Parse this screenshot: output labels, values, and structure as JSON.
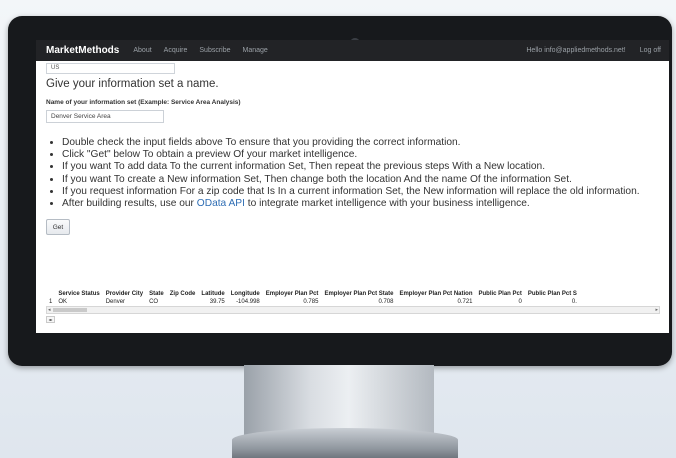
{
  "navbar": {
    "brand": "MarketMethods",
    "links": [
      "About",
      "Acquire",
      "Subscribe",
      "Manage"
    ],
    "greeting": "Hello info@appliedmethods.net!",
    "logoff": "Log off"
  },
  "form": {
    "country_value": "US",
    "section_title": "Give your information set a name.",
    "name_label": "Name of your information set (Example: Service Area Analysis)",
    "name_value": "Denver Service Area"
  },
  "instructions": [
    "Double check the input fields above To ensure that you providing the correct information.",
    "Click \"Get\" below To obtain a preview Of your market intelligence.",
    "If you want To add data To the current information Set, Then repeat the previous steps With a New location.",
    "If you want To create a New information Set, Then change both the location And the name Of the information Set.",
    "If you request information For a zip code that Is In a current information Set, the New information will replace the old information."
  ],
  "last_instruction": {
    "before": "After building results, use our ",
    "link": "OData API",
    "after": " to integrate market intelligence with your business intelligence."
  },
  "get_button": "Get",
  "results": {
    "columns": [
      "",
      "Service Status",
      "Provider City",
      "State",
      "Zip Code",
      "Latitude",
      "Longitude",
      "Employer Plan Pct",
      "Employer Plan Pct State",
      "Employer Plan Pct Nation",
      "Public Plan Pct",
      "Public Plan Pct S"
    ],
    "rows": [
      [
        "1",
        "OK",
        "Denver",
        "CO",
        "",
        "39.75",
        "-104.998",
        "0.785",
        "0.708",
        "0.721",
        "0",
        "0."
      ]
    ]
  }
}
